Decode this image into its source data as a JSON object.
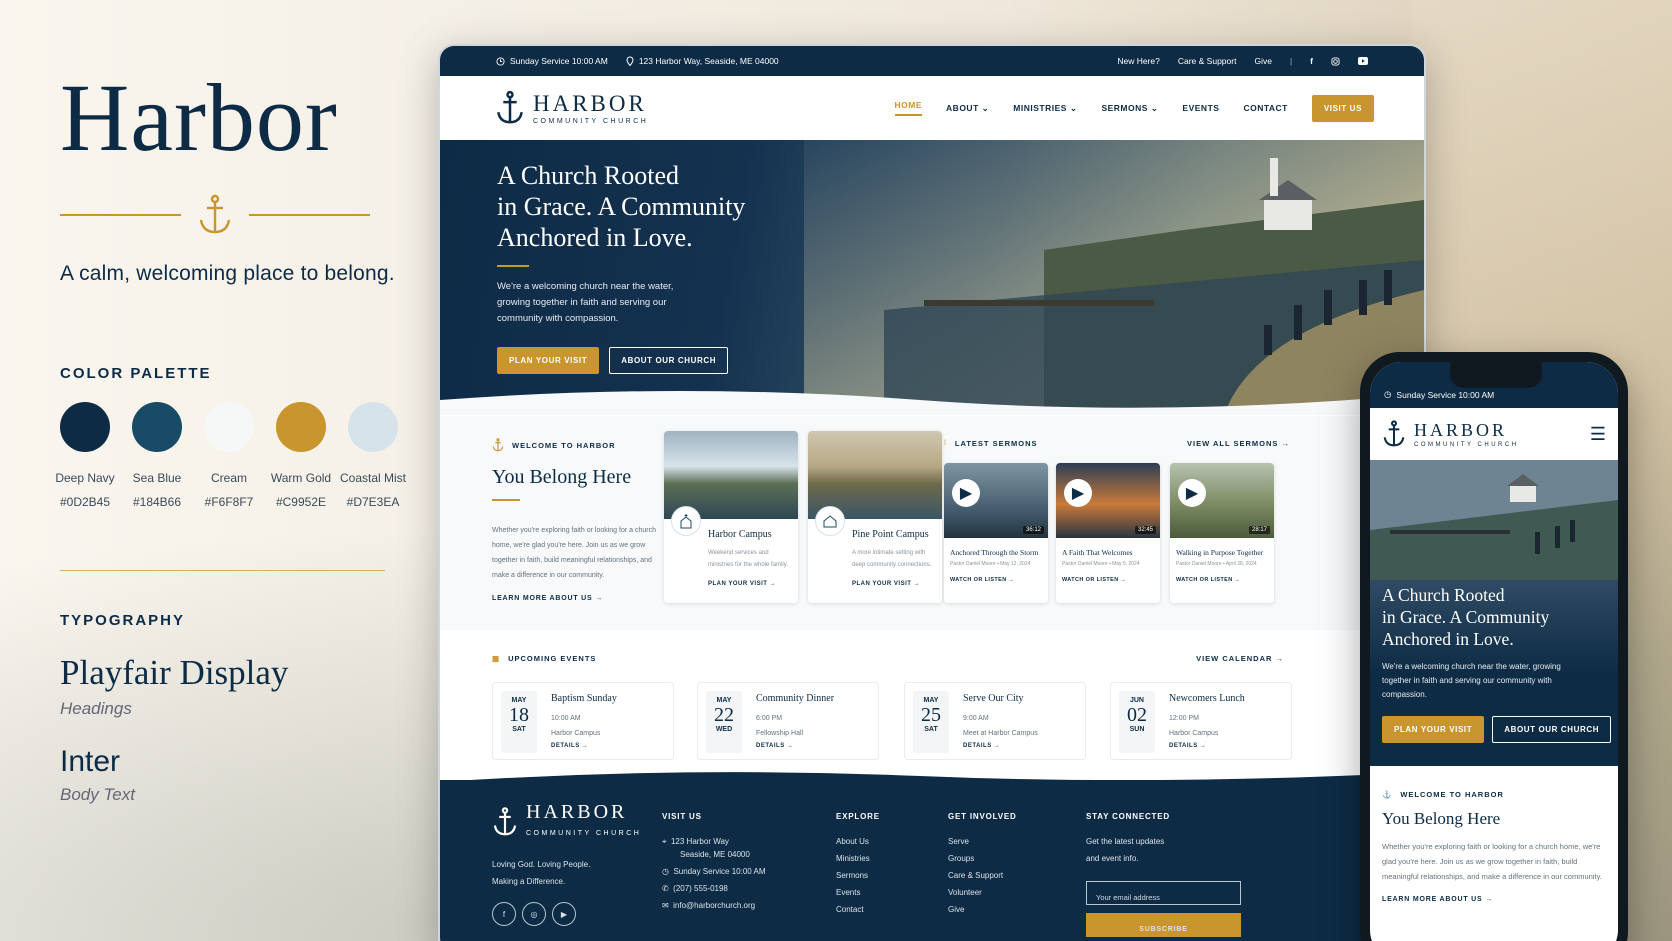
{
  "brand": {
    "title": "Harbor",
    "tagline": "A calm, welcoming place to belong."
  },
  "palette": {
    "heading": "COLOR PALETTE",
    "colors": [
      {
        "name": "Deep Navy",
        "hex": "#0D2B45"
      },
      {
        "name": "Sea Blue",
        "hex": "#184B66"
      },
      {
        "name": "Cream",
        "hex": "#F6F8F7"
      },
      {
        "name": "Warm Gold",
        "hex": "#C9952E"
      },
      {
        "name": "Coastal Mist",
        "hex": "#D7E3EA"
      }
    ]
  },
  "typography": {
    "heading": "TYPOGRAPHY",
    "heading_font": "Playfair Display",
    "heading_font_use": "Headings",
    "body_font": "Inter",
    "body_font_use": "Body Text"
  },
  "site": {
    "topbar": {
      "service": "Sunday Service 10:00 AM",
      "address": "123 Harbor Way, Seaside, ME 04000",
      "links": [
        "New Here?",
        "Care & Support",
        "Give"
      ]
    },
    "logo": {
      "name": "HARBOR",
      "sub": "COMMUNITY CHURCH"
    },
    "nav": {
      "items": [
        "HOME",
        "ABOUT",
        "MINISTRIES",
        "SERMONS",
        "EVENTS",
        "CONTACT"
      ],
      "cta": "VISIT US"
    },
    "hero": {
      "heading_1": "A Church Rooted",
      "heading_2": "in Grace. A Community",
      "heading_3": "Anchored in Love.",
      "body": "We're a welcoming church near the water, growing together in faith and serving our community with compassion.",
      "primary": "PLAN YOUR VISIT",
      "secondary": "ABOUT OUR CHURCH"
    },
    "welcome": {
      "label": "WELCOME TO HARBOR",
      "heading": "You Belong Here",
      "body": "Whether you're exploring faith or looking for a church home, we're glad you're here. Join us as we grow together in faith, build meaningful relationships, and make a difference in our community.",
      "link": "LEARN MORE ABOUT US →"
    },
    "campuses": [
      {
        "name": "Harbor Campus",
        "desc": "Weekend services and ministries for the whole family.",
        "link": "PLAN YOUR VISIT →"
      },
      {
        "name": "Pine Point Campus",
        "desc": "A more intimate setting with deep community connections.",
        "link": "PLAN YOUR VISIT →"
      }
    ],
    "sermons": {
      "label": "LATEST SERMONS",
      "view_all": "VIEW ALL SERMONS →",
      "items": [
        {
          "title": "Anchored Through the Storm",
          "meta": "Pastor Daniel Moore  •  May 12, 2024",
          "duration": "36:12",
          "link": "WATCH OR LISTEN →"
        },
        {
          "title": "A Faith That Welcomes",
          "meta": "Pastor Daniel Moore  •  May 5, 2024",
          "duration": "32:45",
          "link": "WATCH OR LISTEN →"
        },
        {
          "title": "Walking in Purpose Together",
          "meta": "Pastor Daniel Moore  •  April 28, 2024",
          "duration": "28:17",
          "link": "WATCH OR LISTEN →"
        }
      ]
    },
    "events": {
      "label": "UPCOMING EVENTS",
      "view": "VIEW CALENDAR →",
      "items": [
        {
          "month": "MAY",
          "day": "18",
          "weekday": "SAT",
          "title": "Baptism Sunday",
          "time": "10:00 AM",
          "place": "Harbor Campus",
          "link": "DETAILS →"
        },
        {
          "month": "MAY",
          "day": "22",
          "weekday": "WED",
          "title": "Community Dinner",
          "time": "6:00 PM",
          "place": "Fellowship Hall",
          "link": "DETAILS →"
        },
        {
          "month": "MAY",
          "day": "25",
          "weekday": "SAT",
          "title": "Serve Our City",
          "time": "9:00 AM",
          "place": "Meet at Harbor Campus",
          "link": "DETAILS →"
        },
        {
          "month": "JUN",
          "day": "02",
          "weekday": "SUN",
          "title": "Newcomers Lunch",
          "time": "12:00 PM",
          "place": "Harbor Campus",
          "link": "DETAILS →"
        }
      ]
    },
    "footer": {
      "motto_1": "Loving God. Loving People.",
      "motto_2": "Making a Difference.",
      "visit_title": "VISIT US",
      "visit_addr_1": "123 Harbor Way",
      "visit_addr_2": "Seaside, ME 04000",
      "visit_service": "Sunday Service 10:00 AM",
      "visit_phone": "(207) 555-0198",
      "visit_email": "info@harborchurch.org",
      "explore_title": "EXPLORE",
      "explore": [
        "About Us",
        "Ministries",
        "Sermons",
        "Events",
        "Contact"
      ],
      "involved_title": "GET INVOLVED",
      "involved": [
        "Serve",
        "Groups",
        "Care & Support",
        "Volunteer",
        "Give"
      ],
      "connect_title": "STAY CONNECTED",
      "connect_text_1": "Get the latest updates",
      "connect_text_2": "and event info.",
      "email_placeholder": "Your email address",
      "subscribe": "SUBSCRIBE"
    }
  },
  "phone": {
    "status": "Sunday Service 10:00 AM",
    "welcome_link": "LEARN MORE ABOUT US →"
  }
}
